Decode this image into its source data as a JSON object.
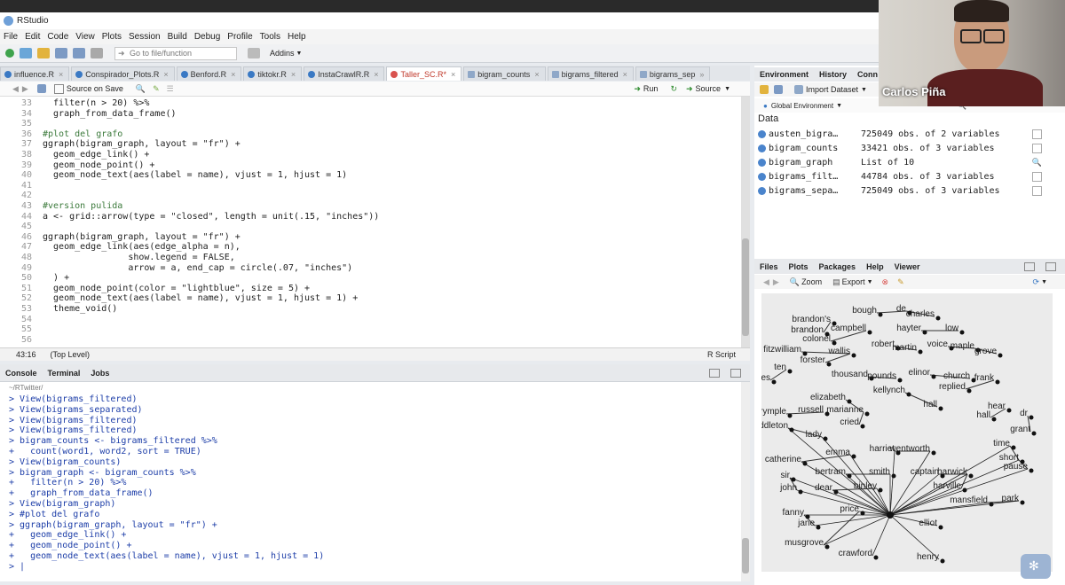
{
  "app_title": "RStudio",
  "menu": [
    "File",
    "Edit",
    "Code",
    "View",
    "Plots",
    "Session",
    "Build",
    "Debug",
    "Profile",
    "Tools",
    "Help"
  ],
  "toolbar": {
    "goto_placeholder": "Go to file/function",
    "addins": "Addins"
  },
  "editor_tabs": [
    {
      "label": "influence.R"
    },
    {
      "label": "Conspirador_Plots.R"
    },
    {
      "label": "Benford.R"
    },
    {
      "label": "tiktokr.R"
    },
    {
      "label": "InstaCrawlR.R"
    },
    {
      "label": "Taller_SC.R*",
      "active": true
    },
    {
      "label": "bigram_counts"
    },
    {
      "label": "bigrams_filtered"
    },
    {
      "label": "bigrams_sep"
    }
  ],
  "editor_toolbar": {
    "source_on_save": "Source on Save",
    "run": "Run",
    "source": "Source"
  },
  "code_lines": [
    {
      "n": "33",
      "t": "  filter(n > 20) %>%",
      "c": ""
    },
    {
      "n": "34",
      "t": "  graph_from_data_frame()",
      "c": ""
    },
    {
      "n": "35",
      "t": "",
      "c": ""
    },
    {
      "n": "36",
      "t": "#plot del grafo",
      "c": "cmt"
    },
    {
      "n": "37",
      "t": "ggraph(bigram_graph, layout = \"fr\") +",
      "c": ""
    },
    {
      "n": "38",
      "t": "  geom_edge_link() +",
      "c": ""
    },
    {
      "n": "39",
      "t": "  geom_node_point() +",
      "c": ""
    },
    {
      "n": "40",
      "t": "  geom_node_text(aes(label = name), vjust = 1, hjust = 1)",
      "c": ""
    },
    {
      "n": "41",
      "t": "",
      "c": ""
    },
    {
      "n": "42",
      "t": "",
      "c": ""
    },
    {
      "n": "43",
      "t": "#version pulida",
      "c": "cmt"
    },
    {
      "n": "44",
      "t": "a <- grid::arrow(type = \"closed\", length = unit(.15, \"inches\"))",
      "c": ""
    },
    {
      "n": "45",
      "t": "",
      "c": ""
    },
    {
      "n": "46",
      "t": "ggraph(bigram_graph, layout = \"fr\") +",
      "c": ""
    },
    {
      "n": "47",
      "t": "  geom_edge_link(aes(edge_alpha = n),",
      "c": ""
    },
    {
      "n": "48",
      "t": "                show.legend = FALSE,",
      "c": ""
    },
    {
      "n": "49",
      "t": "                arrow = a, end_cap = circle(.07, \"inches\")",
      "c": ""
    },
    {
      "n": "50",
      "t": "  ) +",
      "c": ""
    },
    {
      "n": "51",
      "t": "  geom_node_point(color = \"lightblue\", size = 5) +",
      "c": ""
    },
    {
      "n": "52",
      "t": "  geom_node_text(aes(label = name), vjust = 1, hjust = 1) +",
      "c": ""
    },
    {
      "n": "53",
      "t": "  theme_void()",
      "c": ""
    },
    {
      "n": "54",
      "t": "",
      "c": ""
    },
    {
      "n": "55",
      "t": "",
      "c": ""
    },
    {
      "n": "56",
      "t": "",
      "c": ""
    }
  ],
  "editor_status": {
    "position": "43:16",
    "scope": "(Top Level)",
    "filetype": "R Script"
  },
  "console_tabs": [
    "Console",
    "Terminal",
    "Jobs"
  ],
  "console_path": "~/RTwitter/",
  "console_lines": [
    "> View(bigrams_filtered)",
    "> View(bigrams_separated)",
    "> View(bigrams_filtered)",
    "> View(bigrams_filtered)",
    "> bigram_counts <- bigrams_filtered %>%",
    "+   count(word1, word2, sort = TRUE)",
    "> View(bigram_counts)",
    "> bigram_graph <- bigram_counts %>%",
    "+   filter(n > 20) %>%",
    "+   graph_from_data_frame()",
    "> View(bigram_graph)",
    "> #plot del grafo",
    "> ggraph(bigram_graph, layout = \"fr\") +",
    "+   geom_edge_link() +",
    "+   geom_node_point() +",
    "+   geom_node_text(aes(label = name), vjust = 1, hjust = 1)",
    "> |"
  ],
  "env_tabs": [
    "Environment",
    "History",
    "Conn"
  ],
  "env_toolbar": {
    "import": "Import Dataset"
  },
  "global_env": "Global Environment",
  "data_label": "Data",
  "env_rows": [
    {
      "name": "austen_bigra…",
      "desc": "725049 obs. of 2 variables"
    },
    {
      "name": "bigram_counts",
      "desc": "33421 obs. of 3 variables"
    },
    {
      "name": "bigram_graph",
      "desc": "List of 10"
    },
    {
      "name": "bigrams_filt…",
      "desc": "44784 obs. of 3 variables"
    },
    {
      "name": "bigrams_sepa…",
      "desc": "725049 obs. of 3 variables"
    }
  ],
  "files_tabs": [
    "Files",
    "Plots",
    "Packages",
    "Help",
    "Viewer"
  ],
  "plots_toolbar": {
    "zoom": "Zoom",
    "export": "Export"
  },
  "webcam_name": "Carlos Piña",
  "graph_labels": [
    "brandon's",
    "bough",
    "de",
    "charles",
    "brandon",
    "campbell",
    "colonel",
    "hayter",
    "low",
    "robert",
    "martin",
    "voice",
    "maple",
    "grove",
    "fitzwilliam",
    "wallis",
    "forster",
    "ten",
    "minutes",
    "thousand",
    "pounds",
    "elinor",
    "church",
    "replied",
    "frank",
    "kellynch",
    "hall",
    "elizabeth",
    "marianne",
    "dalrymple",
    "russell",
    "cried",
    "hall",
    "hear",
    "dr",
    "grant",
    "middleton",
    "lady",
    "harriet",
    "wentworth",
    "time",
    "short",
    "pause",
    "emma",
    "catherine",
    "bertram",
    "smith",
    "captain",
    "harwick",
    "harville",
    "sir",
    "john",
    "dear",
    "binley",
    "mansfield",
    "park",
    "fanny",
    "jane",
    "price",
    "musgrove",
    "elliot",
    "henry",
    "crawford"
  ]
}
